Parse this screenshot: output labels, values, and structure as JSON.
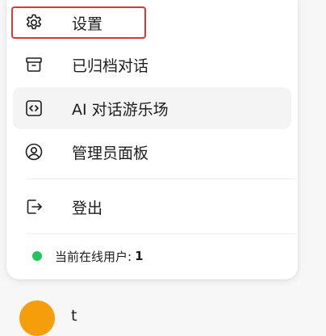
{
  "menu": {
    "items": [
      {
        "label": "设置",
        "icon": "gear-icon"
      },
      {
        "label": "已归档对话",
        "icon": "archive-icon"
      },
      {
        "label": "AI 对话游乐场",
        "icon": "code-icon"
      },
      {
        "label": "管理员面板",
        "icon": "user-circle-icon"
      },
      {
        "label": "登出",
        "icon": "sign-out-icon"
      }
    ],
    "status": {
      "text": "当前在线用户:",
      "count": "1",
      "color": "#22c55e"
    }
  },
  "profile": {
    "name": "t",
    "avatar_color": "#f59e0b"
  },
  "colors": {
    "highlight_box": "#d63a30",
    "hover_bg": "#f4f4f5"
  }
}
